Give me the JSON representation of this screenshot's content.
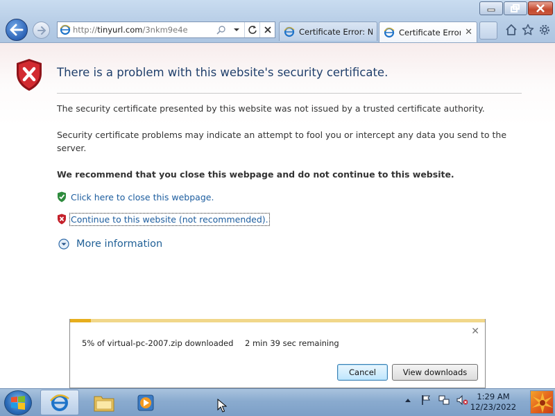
{
  "browser": {
    "address": {
      "host": "tinyurl.com",
      "path": "/3nkm9e4e"
    },
    "tabs": [
      {
        "label": "Certificate Error: N...",
        "active": false
      },
      {
        "label": "Certificate Error...",
        "active": true
      }
    ]
  },
  "page": {
    "heading": "There is a problem with this website's security certificate.",
    "para1": "The security certificate presented by this website was not issued by a trusted certificate authority.",
    "para2": "Security certificate problems may indicate an attempt to fool you or intercept any data you send to the server.",
    "recommend": "We recommend that you close this webpage and do not continue to this website.",
    "close_link": "Click here to close this webpage.",
    "continue_link": "Continue to this website (not recommended).",
    "more_info": "More information"
  },
  "download": {
    "file_text": "5% of virtual-pc-2007.zip downloaded",
    "remaining": "2 min 39 sec remaining",
    "progress": 0.05,
    "cancel_label": "Cancel",
    "view_label": "View downloads"
  },
  "taskbar": {
    "time": "1:29 AM",
    "date": "12/23/2022"
  },
  "colors": {
    "heading": "#1f3f6b",
    "link": "#1b5c9e",
    "progress": "#e7ae1d",
    "danger": "#c4202a",
    "safe": "#2e8b3d"
  }
}
